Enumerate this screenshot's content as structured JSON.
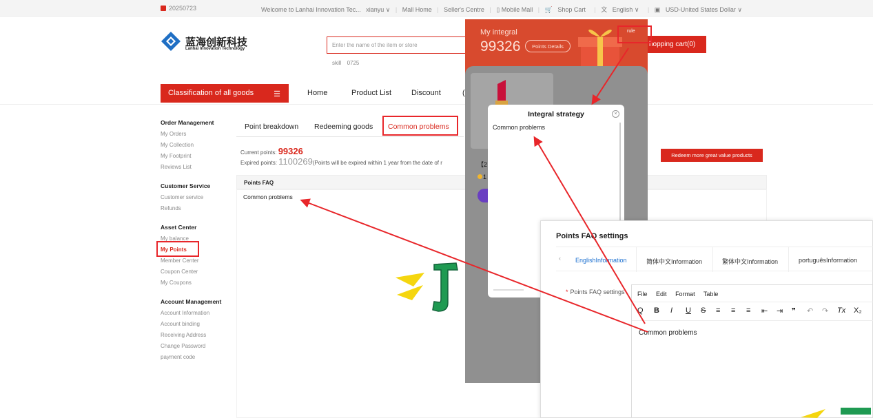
{
  "topbar": {
    "date": "20250723",
    "links": [
      "Welcome to Lanhai Innovation Tec...",
      "xianyu ∨",
      "|",
      "Mall Home",
      "|",
      "Seller's Centre",
      "|",
      "▯ Mobile Mall",
      "|",
      "Shop Cart",
      "|",
      "English ∨",
      "|",
      "USD-United States Dollar ∨"
    ]
  },
  "header": {
    "logo_cn": "蓝海创新科技",
    "logo_en": "Lanhai Innovation Technology",
    "search_placeholder": "Enter the name of the item or store",
    "hot_words": [
      "skill",
      "0725"
    ],
    "cart_label": "hopping cart(0)"
  },
  "nav": {
    "classification": "Classification of all goods",
    "items": [
      "Home",
      "Product List",
      "Discount",
      "("
    ]
  },
  "sidebar": {
    "groups": [
      {
        "title": "Order Management",
        "items": [
          "My Orders",
          "My Collection",
          "My Footprint",
          "Reviews List"
        ]
      },
      {
        "title": "Customer Service",
        "items": [
          "Customer service",
          "Refunds"
        ]
      },
      {
        "title": "Asset Center",
        "items": [
          "My balance",
          "My Points",
          "Member Center",
          "Coupon Center",
          "My Coupons"
        ]
      },
      {
        "title": "Account Management",
        "items": [
          "Account Information",
          "Account binding",
          "Receiving Address",
          "Change Password",
          "payment code"
        ]
      }
    ],
    "active": "My Points"
  },
  "main": {
    "tabs": [
      "Point breakdown",
      "Redeeming goods",
      "Common problems"
    ],
    "active_tab": "Common problems",
    "current_label": "Current points:",
    "current_points": "99326",
    "expired_label": "Expired points:",
    "expired_points": "1100269",
    "expired_note": "(Points will be expired within  1  year from the date of r",
    "redeem_button": "Redeem more great value products",
    "faq_header": "Points FAQ",
    "faq_row": "Common problems"
  },
  "mobile": {
    "my_integral": "My integral",
    "points": "99326",
    "details_button": "Points Details",
    "rule": "rule",
    "product_prefix": "【2",
    "coin_prefix": "1",
    "dialog_title": "Integral strategy",
    "dialog_body": "Common problems"
  },
  "settings": {
    "title": "Points FAQ settings",
    "tabs": [
      "EnglishInformation",
      "简体中文Information",
      "繁体中文Information",
      "portuguêsInformation"
    ],
    "active_tab": "EnglishInformation",
    "field_label": "Points FAQ settings",
    "menu": [
      "File",
      "Edit",
      "Format",
      "Table"
    ],
    "toolbar": [
      "Q",
      "B",
      "I",
      "U",
      "S",
      "≡",
      "≡",
      "≡",
      "⇤",
      "⇥",
      "❞",
      "↶",
      "↷",
      "Tx",
      "X₂"
    ],
    "content": "Common problems"
  },
  "colors": {
    "brand_red": "#d9281d",
    "annotation_red": "#e8262a",
    "link_blue": "#1a6fd0"
  }
}
